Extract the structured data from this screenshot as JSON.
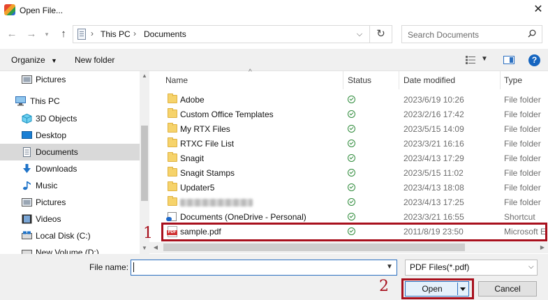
{
  "window": {
    "title": "Open File..."
  },
  "nav": {
    "breadcrumbs": [
      "This PC",
      "Documents"
    ],
    "search_placeholder": "Search Documents"
  },
  "toolbar": {
    "organize": "Organize",
    "new_folder": "New folder"
  },
  "sidebar": {
    "items": [
      {
        "label": "Pictures",
        "icon": "pictures-icon"
      },
      {
        "label": "This PC",
        "icon": "computer-icon"
      },
      {
        "label": "3D Objects",
        "icon": "3d-objects-icon"
      },
      {
        "label": "Desktop",
        "icon": "desktop-icon"
      },
      {
        "label": "Documents",
        "icon": "documents-icon",
        "selected": true
      },
      {
        "label": "Downloads",
        "icon": "download-icon"
      },
      {
        "label": "Music",
        "icon": "music-icon"
      },
      {
        "label": "Pictures",
        "icon": "pictures-icon"
      },
      {
        "label": "Videos",
        "icon": "videos-icon"
      },
      {
        "label": "Local Disk (C:)",
        "icon": "disk-icon"
      },
      {
        "label": "New Volume (D:)",
        "icon": "disk-icon"
      }
    ]
  },
  "columns": {
    "name": "Name",
    "status": "Status",
    "date_modified": "Date modified",
    "type": "Type"
  },
  "files": [
    {
      "name": "Adobe",
      "date": "2023/6/19 10:26",
      "type": "File folder",
      "icon": "folder-icon"
    },
    {
      "name": "Custom Office Templates",
      "date": "2023/2/16 17:42",
      "type": "File folder",
      "icon": "folder-icon"
    },
    {
      "name": "My RTX Files",
      "date": "2023/5/15 14:09",
      "type": "File folder",
      "icon": "folder-icon"
    },
    {
      "name": "RTXC File List",
      "date": "2023/3/21 16:16",
      "type": "File folder",
      "icon": "folder-icon"
    },
    {
      "name": "Snagit",
      "date": "2023/4/13 17:29",
      "type": "File folder",
      "icon": "folder-icon"
    },
    {
      "name": "Snagit Stamps",
      "date": "2023/5/15 11:02",
      "type": "File folder",
      "icon": "folder-icon"
    },
    {
      "name": "Updater5",
      "date": "2023/4/13 18:08",
      "type": "File folder",
      "icon": "folder-icon"
    },
    {
      "name": "",
      "date": "2023/4/13 17:25",
      "type": "File folder",
      "icon": "folder-icon",
      "blurred": true
    },
    {
      "name": "Documents (OneDrive - Personal)",
      "date": "2023/3/21 16:55",
      "type": "Shortcut",
      "icon": "onedrive-shortcut-icon"
    },
    {
      "name": "sample.pdf",
      "date": "2011/8/19 23:50",
      "type": "Microsoft E",
      "icon": "pdf-icon"
    }
  ],
  "bottom": {
    "file_name_label": "File name:",
    "file_name_value": "",
    "filter": "PDF Files(*.pdf)",
    "open": "Open",
    "cancel": "Cancel"
  },
  "annotations": {
    "step1": "1",
    "step2": "2"
  },
  "colors": {
    "highlight": "#a8101d",
    "accent": "#2b6fc0"
  }
}
